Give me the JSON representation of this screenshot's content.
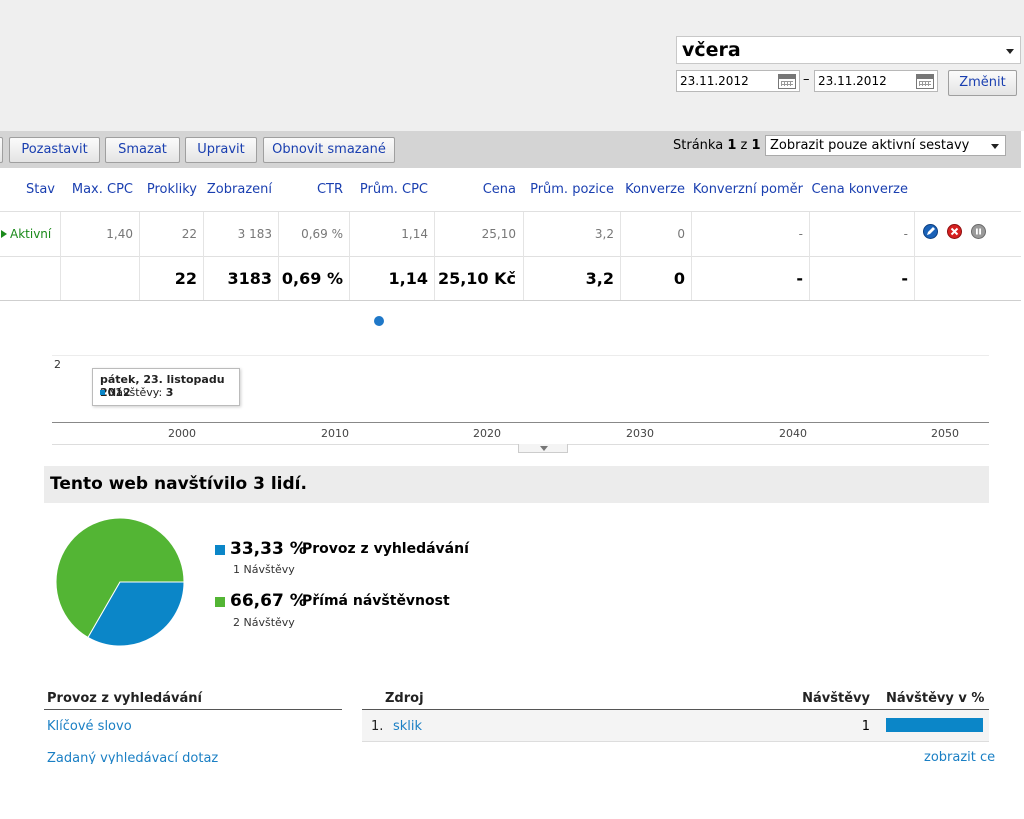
{
  "date_range": {
    "period": "včera",
    "from": "23.11.2012",
    "separator": "–",
    "to": "23.11.2012",
    "change_label": "Změnit"
  },
  "toolbar": {
    "buttons": [
      "Pozastavit",
      "Smazat",
      "Upravit",
      "Obnovit smazané"
    ],
    "page_prefix": "Stránka ",
    "page_current": "1",
    "page_mid": " z ",
    "page_total": "1",
    "filter": "Zobrazit pouze aktivní sestavy"
  },
  "table": {
    "headers": [
      "Stav",
      "Max. CPC",
      "Prokliky",
      "Zobrazení",
      "CTR",
      "Prům. CPC",
      "Cena",
      "Prům. pozice",
      "Konverze",
      "Konverzní poměr",
      "Cena konverze"
    ],
    "row": {
      "status": "Aktivní",
      "max_cpc": "1,40",
      "clicks": "22",
      "impressions": "3 183",
      "ctr": "0,69 %",
      "avg_cpc": "1,14",
      "cost": "25,10",
      "avg_position": "3,2",
      "conversions": "0",
      "conversion_rate": "-",
      "conversion_cost": "-"
    },
    "totals": {
      "clicks": "22",
      "impressions": "3183",
      "ctr": "0,69 %",
      "avg_cpc": "1,14",
      "cost": "25,10 Kč",
      "avg_position": "3,2",
      "conversions": "0",
      "conversion_rate": "-",
      "conversion_cost": "-"
    },
    "action_icons": [
      "edit-icon",
      "delete-icon",
      "pause-icon"
    ]
  },
  "timeline": {
    "y_tick": "2",
    "x_ticks": [
      "2000",
      "2010",
      "2020",
      "2030",
      "2040",
      "2050"
    ],
    "tooltip_date": "pátek, 23. listopadu 2012",
    "tooltip_series": "Návštěvy: ",
    "tooltip_value": "3"
  },
  "visitors": {
    "title": "Tento web navštívilo 3 lidí.",
    "colors": {
      "search": "#0b86c8",
      "direct": "#53b534"
    },
    "legend": [
      {
        "pct": "33,33 %",
        "name": "Provoz z vyhledávání",
        "sub": "1 Návštěvy",
        "fraction": 0.3333
      },
      {
        "pct": "66,67 %",
        "name": "Přímá návštěvnost",
        "sub": "2 Návštěvy",
        "fraction": 0.6667
      }
    ]
  },
  "search_traffic": {
    "title": "Provoz z vyhledávání",
    "links": [
      "Klíčové slovo",
      "Zadaný vyhledávací dotaz"
    ]
  },
  "sources": {
    "headers": [
      "Zdroj",
      "Návštěvy",
      "Návštěvy v %"
    ],
    "rows": [
      {
        "index": "1.",
        "name": "sklik",
        "visits": "1",
        "pct": 1.0
      }
    ],
    "more_link": "zobrazit ce"
  }
}
